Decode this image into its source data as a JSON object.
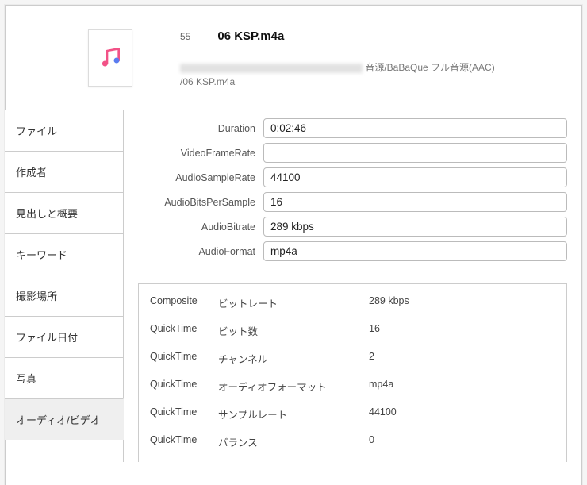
{
  "header": {
    "index": "55",
    "title": "06 KSP.m4a",
    "path_suffix": "音源/BaBaQue フル音源(AAC)",
    "path_line2": "/06 KSP.m4a"
  },
  "tabs": [
    {
      "label": "ファイル",
      "active": false
    },
    {
      "label": "作成者",
      "active": false
    },
    {
      "label": "見出しと概要",
      "active": false
    },
    {
      "label": "キーワード",
      "active": false
    },
    {
      "label": "撮影場所",
      "active": false
    },
    {
      "label": "ファイル日付",
      "active": false
    },
    {
      "label": "写真",
      "active": false
    },
    {
      "label": "オーディオ/ビデオ",
      "active": true
    }
  ],
  "fields": [
    {
      "label": "Duration",
      "value": "0:02:46"
    },
    {
      "label": "VideoFrameRate",
      "value": ""
    },
    {
      "label": "AudioSampleRate",
      "value": "44100"
    },
    {
      "label": "AudioBitsPerSample",
      "value": "16"
    },
    {
      "label": "AudioBitrate",
      "value": "289 kbps"
    },
    {
      "label": "AudioFormat",
      "value": "mp4a"
    }
  ],
  "details": [
    {
      "cat": "Composite",
      "key": "ビットレート",
      "val": "289 kbps"
    },
    {
      "cat": "QuickTime",
      "key": "ビット数",
      "val": "16"
    },
    {
      "cat": "QuickTime",
      "key": "チャンネル",
      "val": "2"
    },
    {
      "cat": "QuickTime",
      "key": "オーディオフォーマット",
      "val": "mp4a"
    },
    {
      "cat": "QuickTime",
      "key": "サンプルレート",
      "val": "44100"
    },
    {
      "cat": "QuickTime",
      "key": "バランス",
      "val": "0"
    }
  ]
}
